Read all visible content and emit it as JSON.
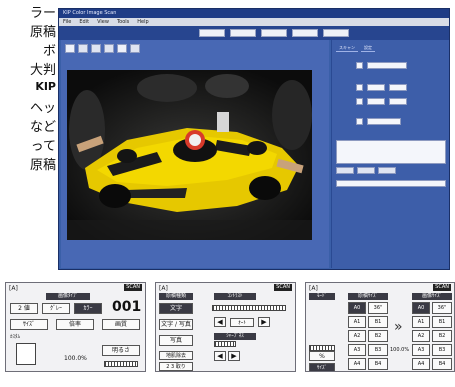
{
  "side_text": [
    "ラー",
    "原稿",
    "ボ",
    "大判",
    "KIP",
    "ヘッ",
    "など",
    "って",
    "原稿"
  ],
  "window": {
    "title": "KIP Color Image Scan",
    "menu": [
      "File",
      "Edit",
      "View",
      "Tools",
      "Help"
    ],
    "top_buttons": [
      "",
      "",
      "",
      "",
      ""
    ],
    "toolbar_icons": [
      "new-icon",
      "open-icon",
      "save-icon",
      "print-icon",
      "zoom-icon",
      "fit-icon"
    ]
  },
  "right_panel": {
    "tabs": [
      "スキャン",
      "設定"
    ],
    "rows": [
      "",
      "",
      "",
      ""
    ],
    "buttons": [
      "",
      "",
      ""
    ]
  },
  "lcd_panels": {
    "image_type": {
      "header": "[A]",
      "scan": "SCAN",
      "section": "画像ﾀｲﾌﾟ",
      "count": "001",
      "btn_2x": "2 値",
      "btn_gray": "ｸﾞﾚｰ",
      "btn_color": "ｶﾗｰ",
      "size": "ｻｲｽﾞ",
      "ratio": "倍率",
      "quality": "画質",
      "auto": "ｶｽﾀﾑ",
      "percent": "100.0%",
      "brightness": "明るさ"
    },
    "original_type": {
      "header": "[A]",
      "scan": "SCAN",
      "section": "原稿種類",
      "contrast": "ｺﾝﾄﾗｽﾄ",
      "text": "文字",
      "text_photo": "文字 / 写真",
      "photo": "写真",
      "sharpness": "ｼｬｰﾌﾟﾈｽ",
      "bg_remove": "地肌除去",
      "two_in_one": "2 3 取り",
      "auto": "ｵｰﾄ"
    },
    "document_size": {
      "header": "[A]",
      "scan": "SCAN",
      "mode": "ﾓｰﾄﾞ",
      "orig_size": "原稿ｻｲｽﾞ",
      "img_size": "画像ｻｲｽﾞ",
      "percent": "100.0%",
      "pct_btn": "%",
      "size_btn": "ｻｲｽﾞ",
      "left_sizes": [
        "A0",
        "36\"",
        "A1",
        "B1",
        "A2",
        "B2",
        "A3",
        "B3",
        "A4",
        "B4"
      ],
      "right_sizes": [
        "A0",
        "36\"",
        "A1",
        "B1",
        "A2",
        "B2",
        "A3",
        "B3",
        "A4",
        "B4"
      ]
    }
  }
}
